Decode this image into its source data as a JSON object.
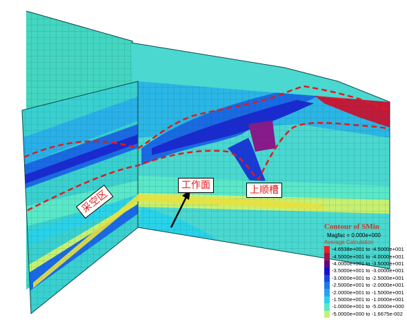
{
  "figure": {
    "callouts": {
      "goaf": "采空区",
      "working_face": "工作面",
      "upper_trough": "上顺槽"
    }
  },
  "legend": {
    "title": "Contour of SMin",
    "magfac": "Magfac =  0.000e+000",
    "calc": "Average Calculation",
    "entries": [
      {
        "label": "-4.6538e+001 to -4.5000e+001",
        "color": "#e8202a"
      },
      {
        "label": "-4.5000e+001 to -4.0000e+001",
        "color": "#a8104a"
      },
      {
        "label": "-4.0000e+001 to -3.5000e+001",
        "color": "#5a0a8a"
      },
      {
        "label": "-3.5000e+001 to -3.0000e+001",
        "color": "#1a10c8"
      },
      {
        "label": "-3.0000e+001 to -2.5000e+001",
        "color": "#1a46e8"
      },
      {
        "label": "-2.5000e+001 to -2.0000e+001",
        "color": "#1a7ae8"
      },
      {
        "label": "-2.0000e+001 to -1.5000e+001",
        "color": "#2aa0f0"
      },
      {
        "label": "-1.5000e+001 to -1.0000e+001",
        "color": "#2ad2e8"
      },
      {
        "label": "-1.0000e+001 to -5.0000e+000",
        "color": "#5ae8c8"
      },
      {
        "label": "-5.0000e+000 to -1.6675e-002",
        "color": "#c8f070"
      }
    ]
  }
}
